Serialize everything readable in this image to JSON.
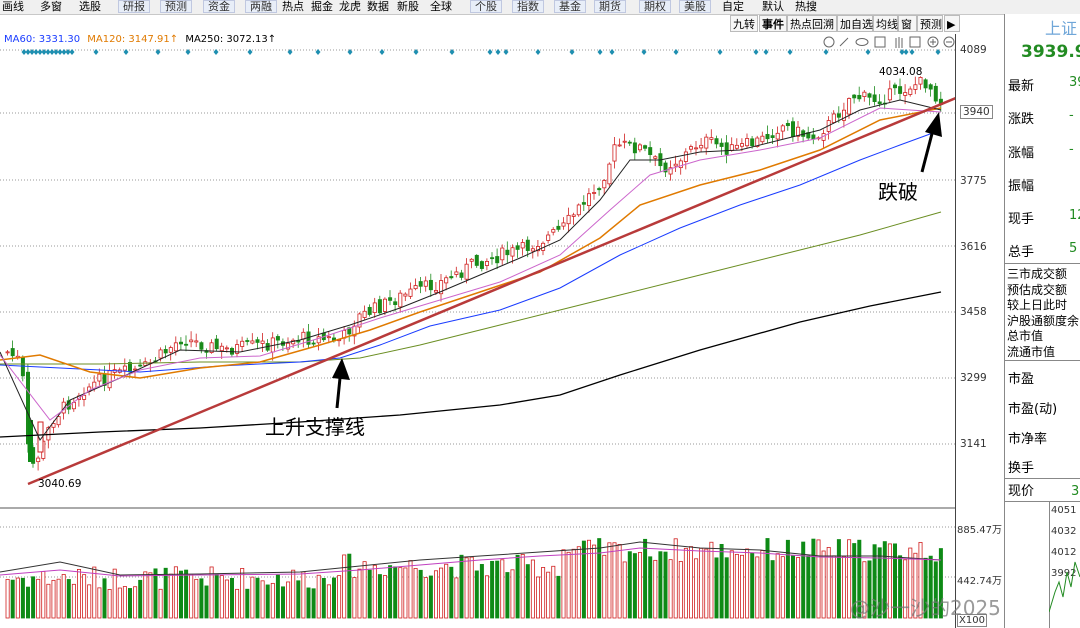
{
  "menu": [
    "画线",
    "多窗",
    "选股",
    "研报",
    "预测",
    "资金",
    "两融",
    "热点",
    "掘金",
    "龙虎",
    "数据",
    "新股",
    "全球",
    "个股",
    "指数",
    "基金",
    "期货",
    "期权",
    "美股",
    "自定",
    "默认",
    "热搜"
  ],
  "toolbar": [
    "九转",
    "事件",
    "热点回溯",
    "加自选",
    "均线",
    "窗",
    "预测"
  ],
  "ma_legend": [
    {
      "label": "MA60: 3331.30",
      "color": "#1a3cff"
    },
    {
      "label": "MA120: 3147.91↑",
      "color": "#e07a00"
    },
    {
      "label": "MA250: 3072.13↑",
      "color": "#000000"
    }
  ],
  "price_axis": [
    "4089",
    "3940",
    "3775",
    "3616",
    "3458",
    "3299",
    "3141"
  ],
  "volume_axis": [
    "885.47万",
    "442.74万",
    "X100"
  ],
  "annotations": {
    "high_label": "4034.08",
    "low_label": "3040.69",
    "support_line": "上升支撑线",
    "breakdown": "跌破"
  },
  "quote": {
    "index_name": "上证",
    "price": "3939.9",
    "fields": [
      {
        "label": "最新",
        "value": "39"
      },
      {
        "label": "涨跌",
        "value": "-"
      },
      {
        "label": "涨幅",
        "value": "-"
      },
      {
        "label": "振幅",
        "value": ""
      },
      {
        "label": "现手",
        "value": "12"
      },
      {
        "label": "总手",
        "value": "5"
      }
    ],
    "stats": [
      "三市成交额",
      "预估成交额",
      "较上日此时",
      "沪股通额度余",
      "总市值",
      "流通市值"
    ],
    "valuation": [
      "市盈",
      "市盈(动)",
      "市净率",
      "换手"
    ],
    "current_price_label": "现价",
    "current_price_value": "3",
    "ladder": [
      "4051",
      "4032",
      "4012",
      "3992"
    ]
  },
  "watermark": "@沙一沙的2025",
  "colors": {
    "up": "#d02020",
    "down": "#1a8a1a",
    "trendline": "#b83a3a",
    "grid": "#a0a0a0"
  }
}
